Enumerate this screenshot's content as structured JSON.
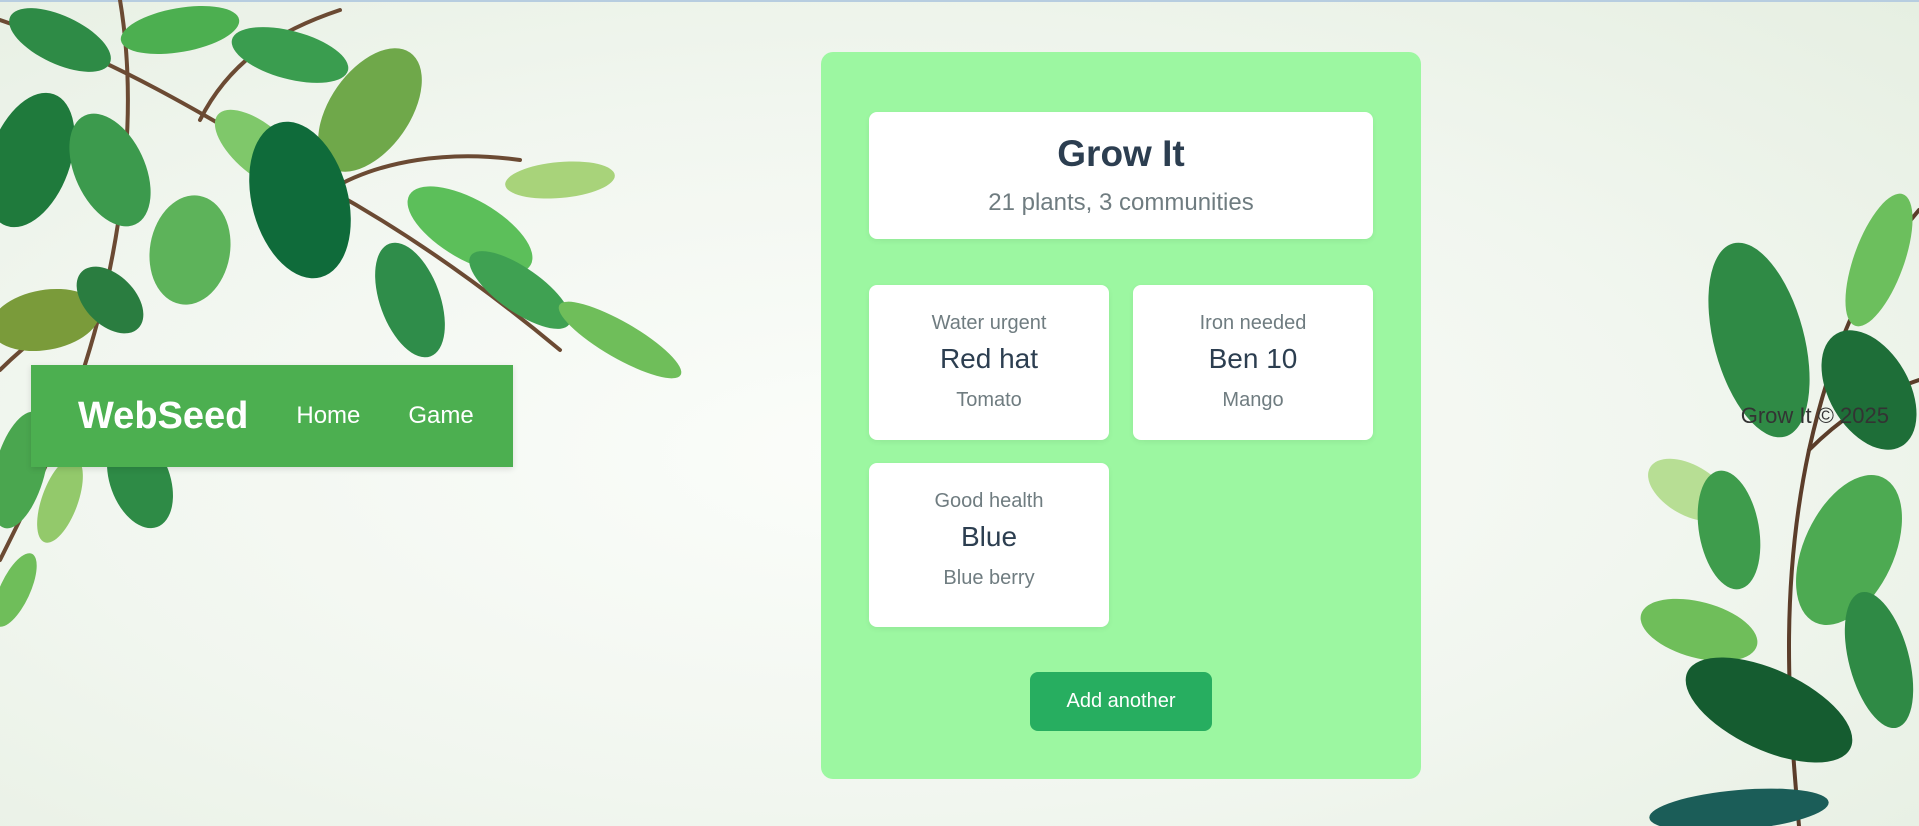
{
  "navbar": {
    "brand": "WebSeed",
    "links": [
      {
        "label": "Home"
      },
      {
        "label": "Game"
      }
    ]
  },
  "footer": {
    "text": "Grow It © 2025"
  },
  "summary": {
    "title": "Grow It",
    "subtitle": "21 plants, 3 communities"
  },
  "plants": [
    {
      "status": "Water urgent",
      "name": "Red hat",
      "species": "Tomato"
    },
    {
      "status": "Iron needed",
      "name": "Ben 10",
      "species": "Mango"
    },
    {
      "status": "Good health",
      "name": "Blue",
      "species": "Blue berry"
    }
  ],
  "actions": {
    "add_label": "Add another"
  },
  "colors": {
    "navbar": "#4caf50",
    "panel": "#9cf7a1",
    "button": "#27ae60",
    "title_text": "#2c3e50",
    "muted_text": "#6f7c80"
  }
}
